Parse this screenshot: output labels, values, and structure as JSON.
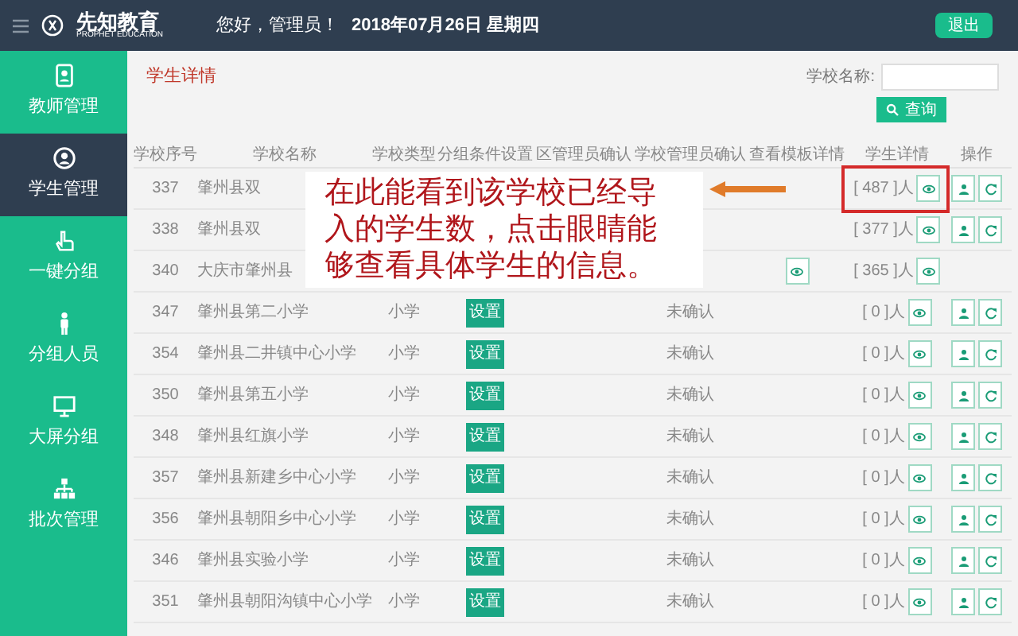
{
  "header": {
    "logo_name": "先知教育",
    "logo_sub": "PROPHET EDUCATION",
    "greeting": "您好，管理员！",
    "date": "2018年07月26日 星期四",
    "logout": "退出"
  },
  "sidebar": {
    "items": [
      {
        "label": "教师管理",
        "selected": false
      },
      {
        "label": "学生管理",
        "selected": true
      },
      {
        "label": "一键分组",
        "selected": false
      },
      {
        "label": "分组人员",
        "selected": false
      },
      {
        "label": "大屏分组",
        "selected": false
      },
      {
        "label": "批次管理",
        "selected": false
      }
    ]
  },
  "page": {
    "title": "学生详情",
    "search_label": "学校名称:",
    "search_button": "查询"
  },
  "table": {
    "columns": [
      "学校序号",
      "学校名称",
      "学校类型",
      "分组条件设置",
      "区管理员确认",
      "学校管理员确认",
      "查看模板详情",
      "学生详情",
      "操作"
    ],
    "rows": [
      {
        "id": "337",
        "name": "肇州县双",
        "count": "[ 487 ]人",
        "template_view": false,
        "actions": true
      },
      {
        "id": "338",
        "name": "肇州县双",
        "count": "[ 377 ]人",
        "template_view": false,
        "actions": true
      },
      {
        "id": "340",
        "name": "大庆市肇州县",
        "count": "[ 365 ]人",
        "template_view": true,
        "actions": false
      },
      {
        "id": "347",
        "name": "肇州县第二小学",
        "type": "小学",
        "setting": "设置",
        "school_confirm": "未确认",
        "count": "[ 0 ]人",
        "template_view": false,
        "actions": true
      },
      {
        "id": "354",
        "name": "肇州县二井镇中心小学",
        "type": "小学",
        "setting": "设置",
        "school_confirm": "未确认",
        "count": "[ 0 ]人",
        "template_view": false,
        "actions": true
      },
      {
        "id": "350",
        "name": "肇州县第五小学",
        "type": "小学",
        "setting": "设置",
        "school_confirm": "未确认",
        "count": "[ 0 ]人",
        "template_view": false,
        "actions": true
      },
      {
        "id": "348",
        "name": "肇州县红旗小学",
        "type": "小学",
        "setting": "设置",
        "school_confirm": "未确认",
        "count": "[ 0 ]人",
        "template_view": false,
        "actions": true
      },
      {
        "id": "357",
        "name": "肇州县新建乡中心小学",
        "type": "小学",
        "setting": "设置",
        "school_confirm": "未确认",
        "count": "[ 0 ]人",
        "template_view": false,
        "actions": true
      },
      {
        "id": "356",
        "name": "肇州县朝阳乡中心小学",
        "type": "小学",
        "setting": "设置",
        "school_confirm": "未确认",
        "count": "[ 0 ]人",
        "template_view": false,
        "actions": true
      },
      {
        "id": "346",
        "name": "肇州县实验小学",
        "type": "小学",
        "setting": "设置",
        "school_confirm": "未确认",
        "count": "[ 0 ]人",
        "template_view": false,
        "actions": true
      },
      {
        "id": "351",
        "name": "肇州县朝阳沟镇中心小学",
        "type": "小学",
        "setting": "设置",
        "school_confirm": "未确认",
        "count": "[ 0 ]人",
        "template_view": false,
        "actions": true
      }
    ]
  },
  "callout": {
    "text": "在此能看到该学校已经导入的学生数，点击眼睛能够查看具体学生的信息。"
  }
}
